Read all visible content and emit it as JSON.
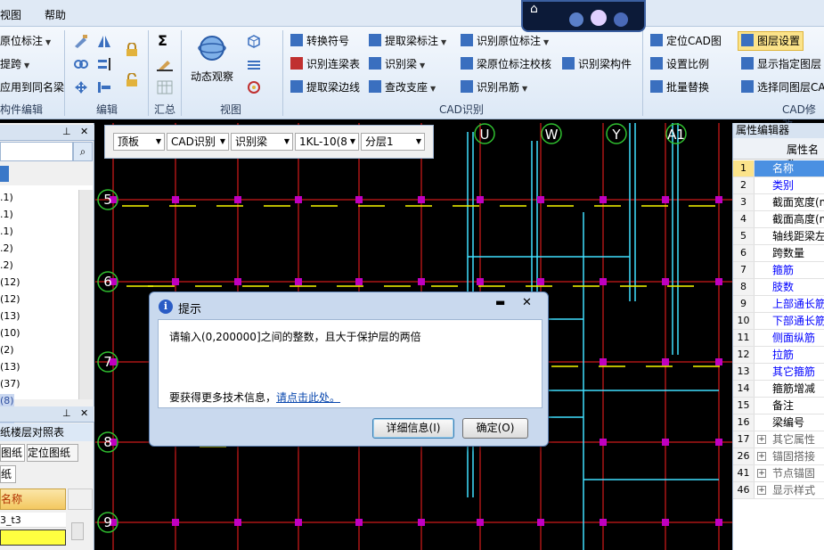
{
  "menubar": {
    "items": [
      "视图",
      "帮助"
    ]
  },
  "ribbon": {
    "group_edit_objects": {
      "items": [
        "原位标注",
        "提跨",
        "应用到同名梁",
        "构件编辑"
      ],
      "label": "构件编辑"
    },
    "group_edit_label": "编辑",
    "group_sum_label": "汇总",
    "group_view": {
      "label": "视图",
      "orbit": "动态观察"
    },
    "group_cad": {
      "label": "CAD识别",
      "items": [
        "转换符号",
        "识别连梁表",
        "提取梁边线",
        "提取梁标注",
        "识别梁",
        "查改支座",
        "识别原位标注",
        "梁原位标注校核",
        "识别吊筋",
        "识别梁构件"
      ]
    },
    "group_cad_edit": {
      "label": "CAD修改",
      "items": [
        "定位CAD图",
        "设置比例",
        "批量替换",
        "图层设置",
        "显示指定图层",
        "选择同图层CA"
      ]
    }
  },
  "leftpanel": {
    "list_rows": [
      ".1)",
      ".1)",
      ".1)",
      ".2)",
      ".2)",
      "(12)",
      "(12)",
      "(13)",
      "(10)",
      "(2)",
      "(13)",
      "(37)",
      "(8)",
      "(8)"
    ],
    "bottom_title": "纸楼层对照表",
    "tabs": [
      "图纸",
      "定位图纸"
    ],
    "subtab": "纸",
    "col_header": "名称",
    "rows": [
      "3_t3",
      ""
    ]
  },
  "filterbar": {
    "combos": [
      "顶板",
      "CAD识别",
      "识别梁",
      "1KL-10(8",
      "分层1"
    ]
  },
  "canvas": {
    "axes_x": [
      "U",
      "W",
      "Y",
      "A1"
    ],
    "axes_y": [
      "5",
      "6",
      "7",
      "8",
      "9"
    ]
  },
  "rightpanel": {
    "title": "属性编辑器",
    "header": "属性名称",
    "rows": [
      {
        "num": "1",
        "name": "名称",
        "color": "#0000ff",
        "plus": false
      },
      {
        "num": "2",
        "name": "类别",
        "color": "#0000ff",
        "plus": false
      },
      {
        "num": "3",
        "name": "截面宽度(m",
        "color": "#000000",
        "plus": false
      },
      {
        "num": "4",
        "name": "截面高度(m",
        "color": "#000000",
        "plus": false
      },
      {
        "num": "5",
        "name": "轴线距梁左",
        "color": "#000000",
        "plus": false
      },
      {
        "num": "6",
        "name": "跨数量",
        "color": "#000000",
        "plus": false
      },
      {
        "num": "7",
        "name": "箍筋",
        "color": "#0000ff",
        "plus": false
      },
      {
        "num": "8",
        "name": "肢数",
        "color": "#0000ff",
        "plus": false
      },
      {
        "num": "9",
        "name": "上部通长筋",
        "color": "#0000ff",
        "plus": false
      },
      {
        "num": "10",
        "name": "下部通长筋",
        "color": "#0000ff",
        "plus": false
      },
      {
        "num": "11",
        "name": "侧面纵筋",
        "color": "#0000ff",
        "plus": false
      },
      {
        "num": "12",
        "name": "拉筋",
        "color": "#0000ff",
        "plus": false
      },
      {
        "num": "13",
        "name": "其它箍筋",
        "color": "#0000ff",
        "plus": false
      },
      {
        "num": "14",
        "name": "箍筋增减",
        "color": "#000000",
        "plus": false
      },
      {
        "num": "15",
        "name": "备注",
        "color": "#000000",
        "plus": false
      },
      {
        "num": "16",
        "name": "梁编号",
        "color": "#000000",
        "plus": false
      },
      {
        "num": "17",
        "name": "其它属性",
        "color": "#666666",
        "plus": true
      },
      {
        "num": "26",
        "name": "锚固搭接",
        "color": "#666666",
        "plus": true
      },
      {
        "num": "41",
        "name": "节点锚固",
        "color": "#666666",
        "plus": true
      },
      {
        "num": "46",
        "name": "显示样式",
        "color": "#666666",
        "plus": true
      }
    ]
  },
  "dialog": {
    "title": "提示",
    "message": "请输入(0,200000]之间的整数，且大于保护层的两倍",
    "more_prefix": "要获得更多技术信息，",
    "more_link": "请点击此处。",
    "details_button": "详细信息(I)",
    "ok_button": "确定(O)"
  },
  "colors": {
    "canvas_bg": "#000000",
    "beam_red": "#ff2020",
    "column_magenta": "#c000c0",
    "wall_cyan": "#40e0ff",
    "text_yellow": "#e8e800",
    "axis_green": "#30c030"
  }
}
